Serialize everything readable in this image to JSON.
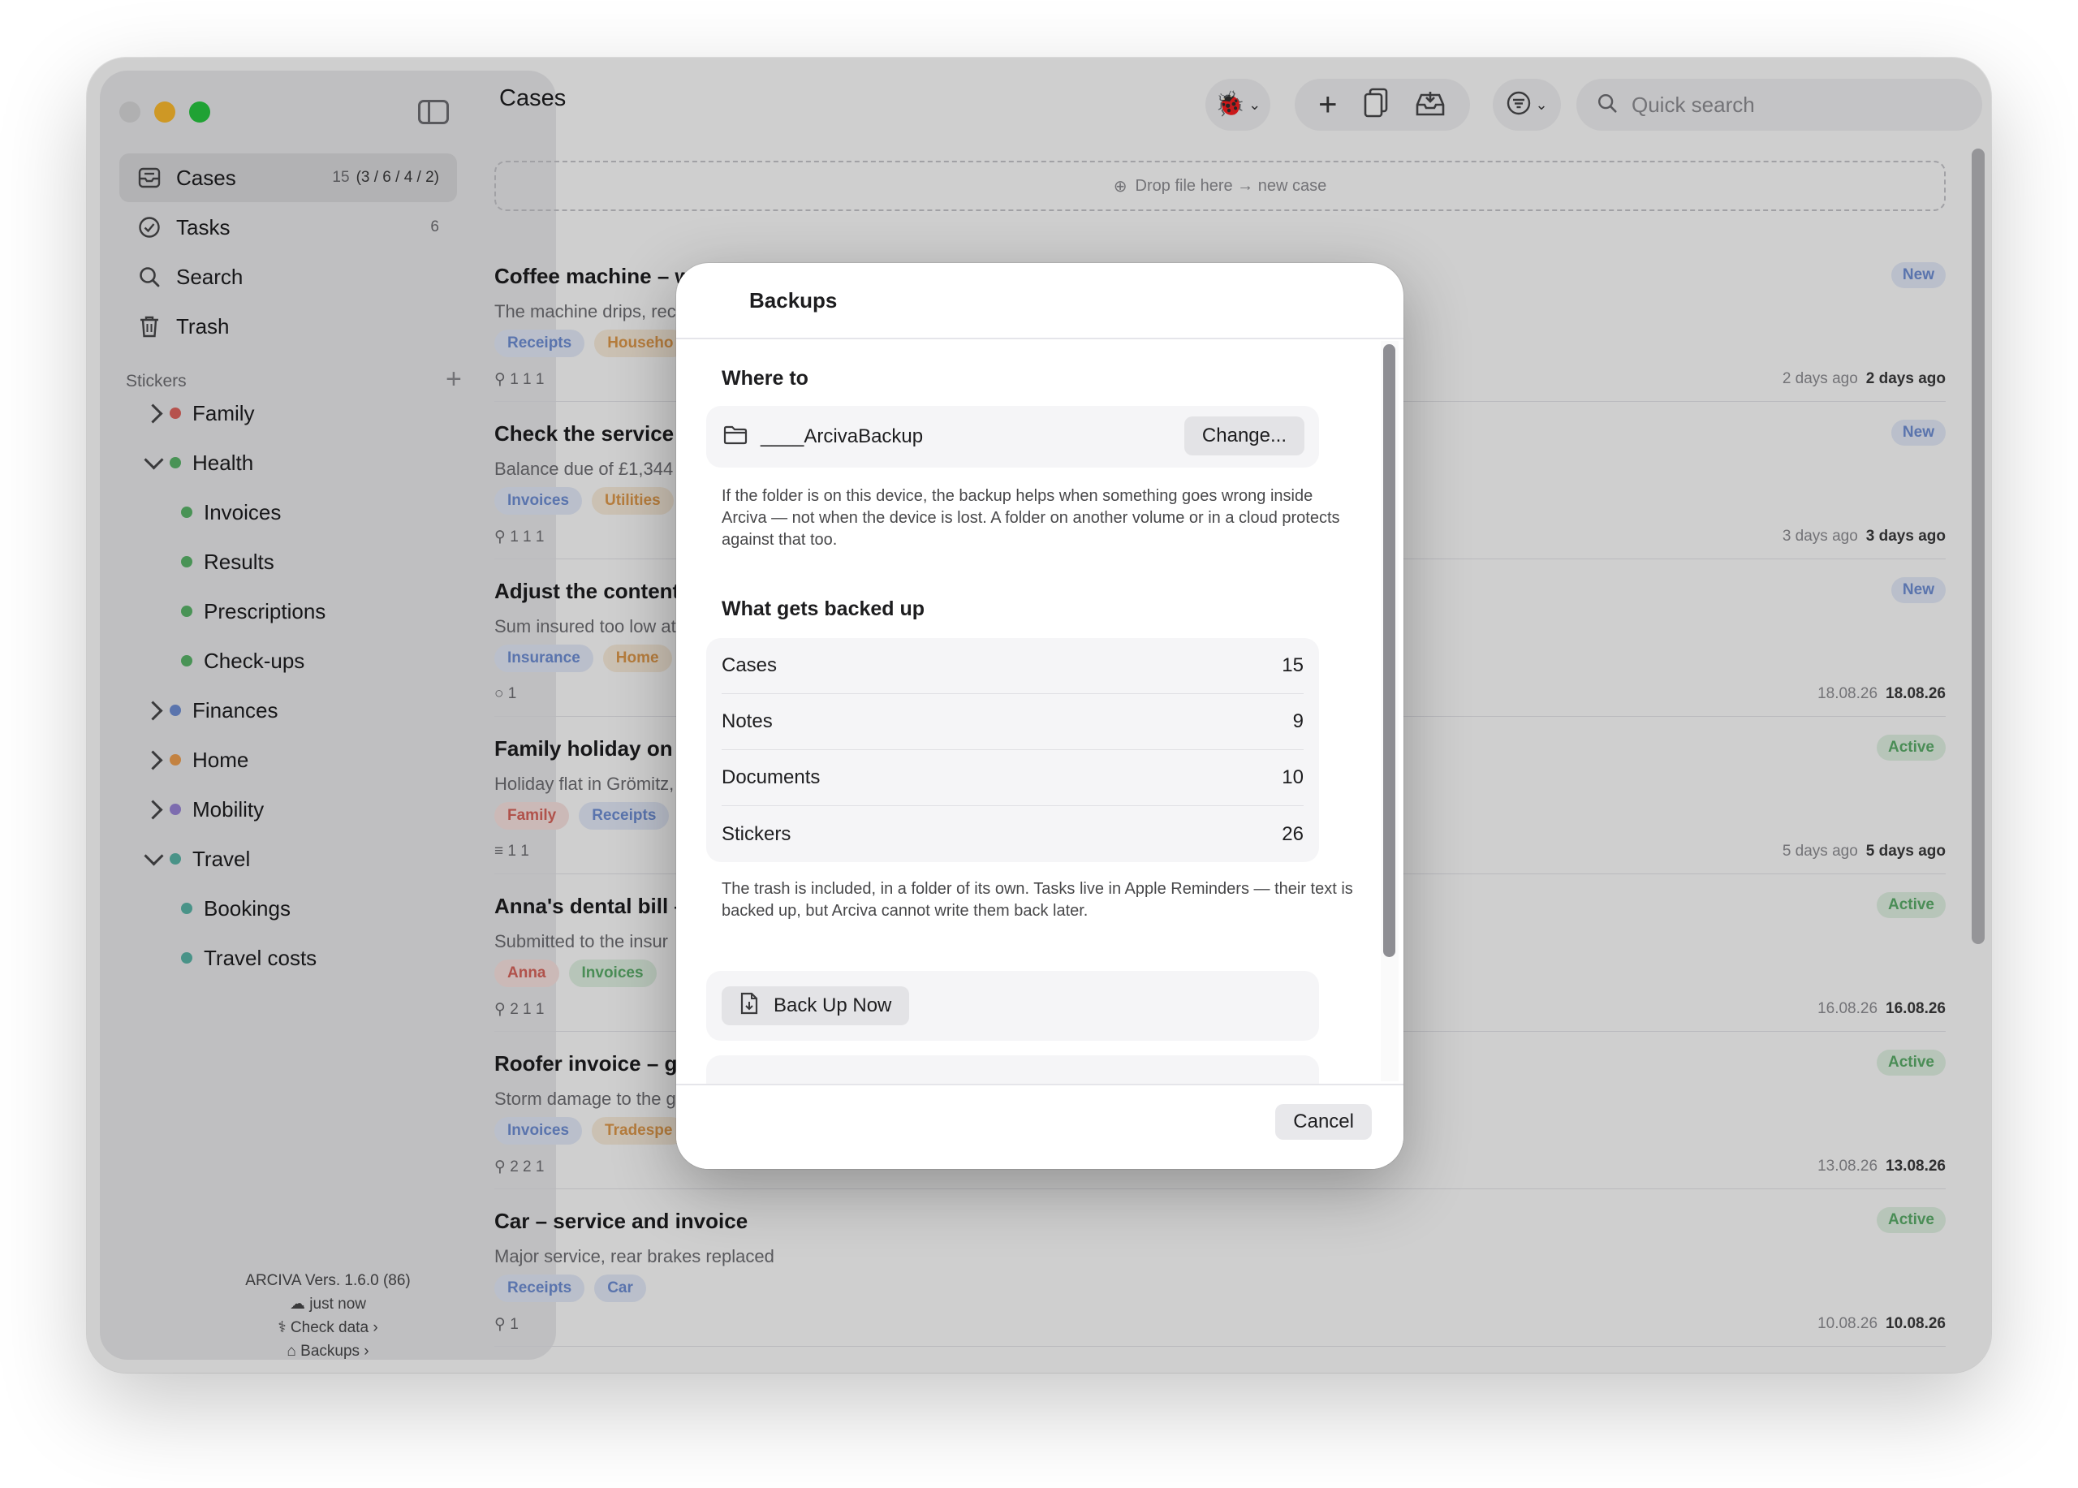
{
  "sidebar": {
    "nav": [
      {
        "label": "Cases",
        "count": "15",
        "sub": "(3 / 6 / 4 / 2)"
      },
      {
        "label": "Tasks",
        "count": "6"
      },
      {
        "label": "Search"
      },
      {
        "label": "Trash"
      }
    ],
    "stickers_heading": "Stickers",
    "stickers": [
      {
        "label": "Family",
        "color": "#e0665f",
        "state": "collapsed"
      },
      {
        "label": "Health",
        "color": "#5bb56a",
        "state": "expanded"
      },
      {
        "label": "Invoices",
        "color": "#5bb56a",
        "child": true
      },
      {
        "label": "Results",
        "color": "#5bb56a",
        "child": true
      },
      {
        "label": "Prescriptions",
        "color": "#5bb56a",
        "child": true
      },
      {
        "label": "Check-ups",
        "color": "#5bb56a",
        "child": true
      },
      {
        "label": "Finances",
        "color": "#6f8fd6",
        "state": "collapsed"
      },
      {
        "label": "Home",
        "color": "#f0a050",
        "state": "collapsed"
      },
      {
        "label": "Mobility",
        "color": "#9a85d8",
        "state": "collapsed"
      },
      {
        "label": "Travel",
        "color": "#5bb5a8",
        "state": "expanded"
      },
      {
        "label": "Bookings",
        "color": "#5bb5a8",
        "child": true
      },
      {
        "label": "Travel costs",
        "color": "#5bb5a8",
        "child": true
      }
    ],
    "footer": {
      "version": "ARCIVA  Vers. 1.6.0 (86)",
      "sync": "just now",
      "check_data": "Check data",
      "backups": "Backups"
    }
  },
  "main": {
    "title": "Cases",
    "search_placeholder": "Quick search",
    "dropzone": "Drop file here → new case",
    "cases": [
      {
        "title": "Coffee machine – w",
        "subtitle": "The machine drips, rec",
        "tags": [
          "Receipts",
          "Househo"
        ],
        "meta": "1   1   1",
        "status": "New",
        "created": "2 days ago",
        "modified": "2 days ago"
      },
      {
        "title": "Check the service",
        "subtitle": "Balance due of £1,344",
        "tags": [
          "Invoices",
          "Utilities"
        ],
        "meta": "1   1   1",
        "status": "New",
        "created": "3 days ago",
        "modified": "3 days ago"
      },
      {
        "title": "Adjust the content",
        "subtitle": "Sum insured too low at",
        "tags": [
          "Insurance",
          "Home"
        ],
        "meta": "1",
        "status": "New",
        "created": "18.08.26",
        "modified": "18.08.26"
      },
      {
        "title": "Family holiday on t",
        "subtitle": "Holiday flat in Grömitz,",
        "tags": [
          "Family",
          "Receipts"
        ],
        "meta": "1   1",
        "status": "Active",
        "created": "5 days ago",
        "modified": "5 days ago"
      },
      {
        "title": "Anna's dental bill –",
        "subtitle": "Submitted to the insur",
        "tags": [
          "Anna",
          "Invoices"
        ],
        "meta": "2   1   1",
        "status": "Active",
        "created": "16.08.26",
        "modified": "16.08.26"
      },
      {
        "title": "Roofer invoice – ga",
        "subtitle": "Storm damage to the g",
        "tags": [
          "Invoices",
          "Tradespe"
        ],
        "meta": "2   2   1",
        "status": "Active",
        "created": "13.08.26",
        "modified": "13.08.26"
      },
      {
        "title": "Car – service and invoice",
        "subtitle": "Major service, rear brakes replaced",
        "tags": [
          "Receipts",
          "Car"
        ],
        "meta": "1",
        "status": "Active",
        "created": "10.08.26",
        "modified": "10.08.26"
      }
    ]
  },
  "modal": {
    "title": "Backups",
    "where_to_heading": "Where to",
    "folder_name": "____ArcivaBackup",
    "change_label": "Change...",
    "where_help": "If the folder is on this device, the backup helps when something goes wrong inside Arciva — not when the device is lost. A folder on another volume or in a cloud protects against that too.",
    "what_heading": "What gets backed up",
    "stats": [
      {
        "label": "Cases",
        "value": "15"
      },
      {
        "label": "Notes",
        "value": "9"
      },
      {
        "label": "Documents",
        "value": "10"
      },
      {
        "label": "Stickers",
        "value": "26"
      }
    ],
    "what_help": "The trash is included, in a folder of its own. Tasks live in Apple Reminders — their text is backed up, but Arciva cannot write them back later.",
    "backup_now_label": "Back Up Now",
    "cancel_label": "Cancel"
  },
  "colors": {
    "tag_blue_bg": "#e5ecfa",
    "tag_blue_fg": "#6f8fd6",
    "tag_orange_bg": "#fbeedd",
    "tag_orange_fg": "#e09a4c",
    "tag_red_bg": "#fbe4e2",
    "tag_red_fg": "#d9655d",
    "tag_green_bg": "#e2f3e4",
    "tag_green_fg": "#5cae6a"
  }
}
